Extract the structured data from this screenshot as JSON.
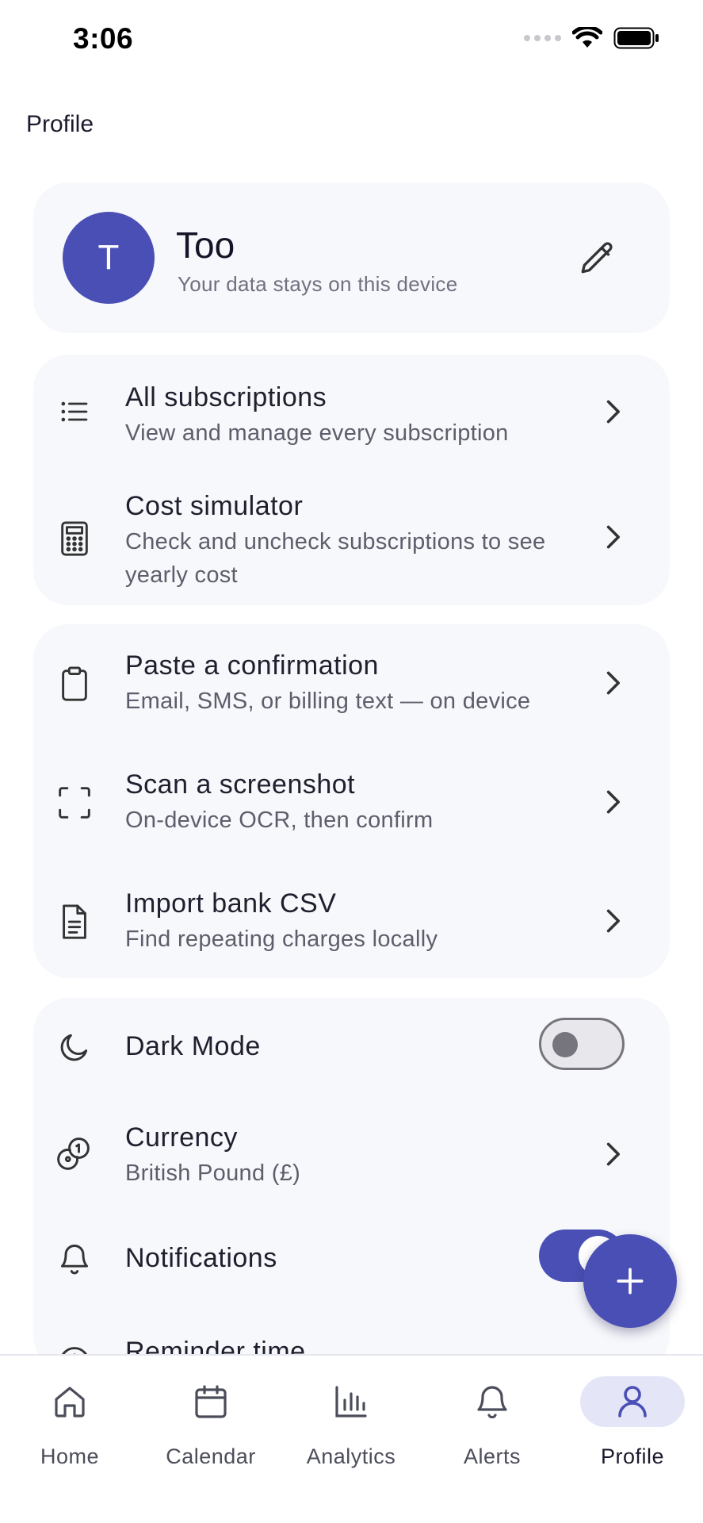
{
  "status_bar": {
    "time": "3:06"
  },
  "page": {
    "title": "Profile"
  },
  "profile": {
    "initial": "T",
    "name": "Too",
    "subtitle": "Your data stays on this device",
    "avatar_color": "#4a4fb5"
  },
  "browse": {
    "items": [
      {
        "title": "All subscriptions",
        "subtitle": "View and manage every subscription",
        "icon": "list-icon"
      },
      {
        "title": "Cost simulator",
        "subtitle": "Check and uncheck subscriptions to see yearly cost",
        "icon": "calculator-icon"
      }
    ]
  },
  "import": {
    "items": [
      {
        "title": "Paste a confirmation",
        "subtitle": "Email, SMS, or billing text — on device",
        "icon": "clipboard-icon"
      },
      {
        "title": "Scan a screenshot",
        "subtitle": "On-device OCR, then confirm",
        "icon": "scan-icon"
      },
      {
        "title": "Import bank CSV",
        "subtitle": "Find repeating charges locally",
        "icon": "document-icon"
      }
    ]
  },
  "settings": {
    "dark_mode": {
      "title": "Dark Mode",
      "enabled": false
    },
    "currency": {
      "title": "Currency",
      "value": "British Pound (£)"
    },
    "notifications": {
      "title": "Notifications",
      "enabled": true
    },
    "reminder_time": {
      "title": "Reminder time"
    }
  },
  "tabs": [
    {
      "label": "Home",
      "icon": "home-icon",
      "active": false
    },
    {
      "label": "Calendar",
      "icon": "calendar-icon",
      "active": false
    },
    {
      "label": "Analytics",
      "icon": "bar-chart-icon",
      "active": false
    },
    {
      "label": "Alerts",
      "icon": "bell-icon",
      "active": false
    },
    {
      "label": "Profile",
      "icon": "user-icon",
      "active": true
    }
  ],
  "colors": {
    "accent": "#4a4fb5",
    "card_bg": "#f7f8fb",
    "active_tab_bg": "#e4e6f8"
  }
}
